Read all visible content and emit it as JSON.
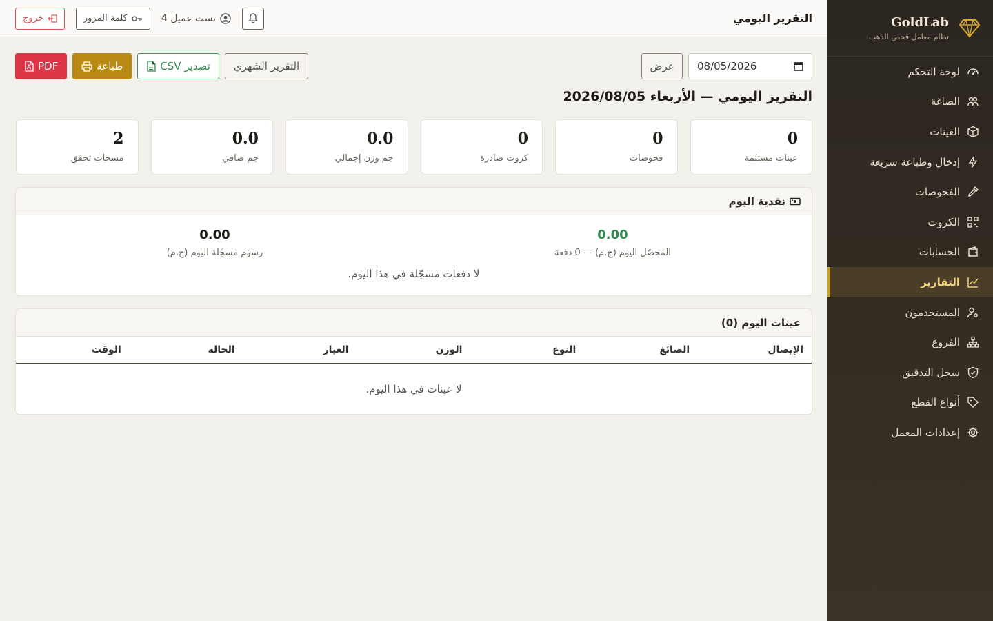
{
  "brand": {
    "title": "GoldLab",
    "subtitle": "نظام معامل فحص الذهب"
  },
  "sidebar": {
    "items": [
      {
        "label": "لوحة التحكم",
        "icon": "dashboard-icon"
      },
      {
        "label": "الصاغة",
        "icon": "users-icon"
      },
      {
        "label": "العينات",
        "icon": "box-icon"
      },
      {
        "label": "إدخال وطباعة سريعة",
        "icon": "lightning-icon"
      },
      {
        "label": "الفحوصات",
        "icon": "pipette-icon"
      },
      {
        "label": "الكروت",
        "icon": "qr-icon"
      },
      {
        "label": "الحسابات",
        "icon": "wallet-icon"
      },
      {
        "label": "التقارير",
        "icon": "chart-icon"
      },
      {
        "label": "المستخدمون",
        "icon": "user-gear-icon"
      },
      {
        "label": "الفروع",
        "icon": "branches-icon"
      },
      {
        "label": "سجل التدقيق",
        "icon": "shield-icon"
      },
      {
        "label": "أنواع القطع",
        "icon": "tag-icon"
      },
      {
        "label": "إعدادات المعمل",
        "icon": "gear-icon"
      }
    ],
    "active_index": 7
  },
  "topbar": {
    "title": "التقرير اليومي",
    "user": "تست عميل 4",
    "password_label": "كلمة المرور",
    "logout_label": "خروج"
  },
  "toolbar": {
    "date_value": "08/05/2026",
    "view_label": "عرض",
    "monthly_label": "التقرير الشهري",
    "csv_label": "تصدير CSV",
    "print_label": "طباعة",
    "pdf_label": "PDF"
  },
  "report_title": "التقرير اليومي — الأربعاء 2026/08/05",
  "stats": [
    {
      "value": "0",
      "label": "عينات مستلمة"
    },
    {
      "value": "0",
      "label": "فحوصات"
    },
    {
      "value": "0",
      "label": "كروت صادرة"
    },
    {
      "value": "0.0",
      "label": "جم وزن إجمالي"
    },
    {
      "value": "0.0",
      "label": "جم صافي"
    },
    {
      "value": "2",
      "label": "مسحات تحقق"
    }
  ],
  "cash": {
    "title": "نقدية اليوم",
    "collected_value": "0.00",
    "collected_label": "المحصّل اليوم (ج.م) — 0 دفعة",
    "fees_value": "0.00",
    "fees_label": "رسوم مسجّلة اليوم (ج.م)",
    "empty": "لا دفعات مسجّلة في هذا اليوم."
  },
  "samples": {
    "title": "عينات اليوم (0)",
    "columns": [
      "الإيصال",
      "الصائغ",
      "النوع",
      "الوزن",
      "العيار",
      "الحالة",
      "الوقت"
    ],
    "empty": "لا عينات في هذا اليوم."
  },
  "colors": {
    "accent": "#b88a14",
    "sidebar": "#2b2620",
    "success": "#2f8a4d",
    "danger": "#dc3545"
  }
}
